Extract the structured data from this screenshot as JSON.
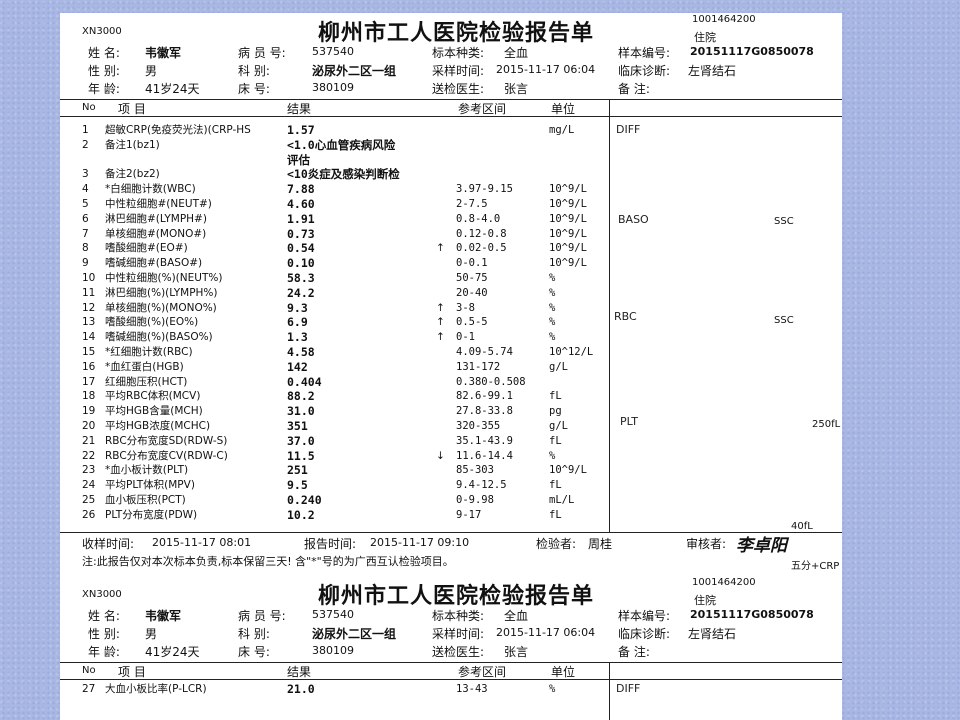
{
  "report": {
    "analyzer": "XN3000",
    "hospital_title": "柳州市工人医院检验报告单",
    "patient_id": "1001464200",
    "admission": "住院",
    "fields": {
      "name_label": "姓 名:",
      "name": "韦徽军",
      "sex_label": "性 别:",
      "sex": "男",
      "age_label": "年 龄:",
      "age": "41岁24天",
      "case_label": "病 员 号:",
      "case_no": "537540",
      "dept_label": "科    别:",
      "dept": "泌尿外二区一组",
      "bed_label": "床    号:",
      "bed": "380109",
      "specimen_type_label": "标本种类:",
      "specimen_type": "全血",
      "collect_time_label": "采样时间:",
      "collect_time": "2015-11-17 06:04",
      "doctor_label": "送检医生:",
      "doctor": "张言",
      "sample_no_label": "样本编号:",
      "sample_no": "20151117G0850078",
      "diagnosis_label": "临床诊断:",
      "diagnosis": "左肾结石",
      "remark_label": "备    注:",
      "remark": ""
    },
    "columns": {
      "no": "No",
      "item": "项    目",
      "result": "结果",
      "ref": "参考区间",
      "unit": "单位"
    },
    "rows": [
      {
        "no": "1",
        "name": "超敏CRP(免疫荧光法)(CRP-HS",
        "result": "1.57",
        "flag": "",
        "ref": "",
        "unit": "mg/L"
      },
      {
        "no": "2",
        "name": "备注1(bz1)",
        "result": "<1.0心血管疾病风险",
        "flag": "",
        "ref": "",
        "unit": ""
      },
      {
        "no": "",
        "name": "",
        "result": "评估",
        "flag": "",
        "ref": "",
        "unit": ""
      },
      {
        "no": "3",
        "name": "备注2(bz2)",
        "result": "<10炎症及感染判断检",
        "flag": "",
        "ref": "",
        "unit": ""
      },
      {
        "no": "4",
        "name": "*白细胞计数(WBC)",
        "result": "7.88",
        "flag": "",
        "ref": "3.97-9.15",
        "unit": "10^9/L"
      },
      {
        "no": "5",
        "name": "中性粒细胞#(NEUT#)",
        "result": "4.60",
        "flag": "",
        "ref": "2-7.5",
        "unit": "10^9/L"
      },
      {
        "no": "6",
        "name": "淋巴细胞#(LYMPH#)",
        "result": "1.91",
        "flag": "",
        "ref": "0.8-4.0",
        "unit": "10^9/L"
      },
      {
        "no": "7",
        "name": "单核细胞#(MONO#)",
        "result": "0.73",
        "flag": "",
        "ref": "0.12-0.8",
        "unit": "10^9/L"
      },
      {
        "no": "8",
        "name": "嗜酸细胞#(EO#)",
        "result": "0.54",
        "flag": "↑",
        "ref": "0.02-0.5",
        "unit": "10^9/L"
      },
      {
        "no": "9",
        "name": "嗜碱细胞#(BASO#)",
        "result": "0.10",
        "flag": "",
        "ref": "0-0.1",
        "unit": "10^9/L"
      },
      {
        "no": "10",
        "name": "中性粒细胞(%)(NEUT%)",
        "result": "58.3",
        "flag": "",
        "ref": "50-75",
        "unit": "%"
      },
      {
        "no": "11",
        "name": "淋巴细胞(%)(LYMPH%)",
        "result": "24.2",
        "flag": "",
        "ref": "20-40",
        "unit": "%"
      },
      {
        "no": "12",
        "name": "单核细胞(%)(MONO%)",
        "result": "9.3",
        "flag": "↑",
        "ref": "3-8",
        "unit": "%"
      },
      {
        "no": "13",
        "name": "嗜酸细胞(%)(EO%)",
        "result": "6.9",
        "flag": "↑",
        "ref": "0.5-5",
        "unit": "%"
      },
      {
        "no": "14",
        "name": "嗜碱细胞(%)(BASO%)",
        "result": "1.3",
        "flag": "↑",
        "ref": "0-1",
        "unit": "%"
      },
      {
        "no": "15",
        "name": "*红细胞计数(RBC)",
        "result": "4.58",
        "flag": "",
        "ref": "4.09-5.74",
        "unit": "10^12/L"
      },
      {
        "no": "16",
        "name": "*血红蛋白(HGB)",
        "result": "142",
        "flag": "",
        "ref": "131-172",
        "unit": "g/L"
      },
      {
        "no": "17",
        "name": "红细胞压积(HCT)",
        "result": "0.404",
        "flag": "",
        "ref": "0.380-0.508",
        "unit": ""
      },
      {
        "no": "18",
        "name": "平均RBC体积(MCV)",
        "result": "88.2",
        "flag": "",
        "ref": "82.6-99.1",
        "unit": "fL"
      },
      {
        "no": "19",
        "name": "平均HGB含量(MCH)",
        "result": "31.0",
        "flag": "",
        "ref": "27.8-33.8",
        "unit": "pg"
      },
      {
        "no": "20",
        "name": "平均HGB浓度(MCHC)",
        "result": "351",
        "flag": "",
        "ref": "320-355",
        "unit": "g/L"
      },
      {
        "no": "21",
        "name": "RBC分布宽度SD(RDW-S)",
        "result": "37.0",
        "flag": "",
        "ref": "35.1-43.9",
        "unit": "fL"
      },
      {
        "no": "22",
        "name": "RBC分布宽度CV(RDW-C)",
        "result": "11.5",
        "flag": "↓",
        "ref": "11.6-14.4",
        "unit": "%"
      },
      {
        "no": "23",
        "name": "*血小板计数(PLT)",
        "result": "251",
        "flag": "",
        "ref": "85-303",
        "unit": "10^9/L"
      },
      {
        "no": "24",
        "name": "平均PLT体积(MPV)",
        "result": "9.5",
        "flag": "",
        "ref": "9.4-12.5",
        "unit": "fL"
      },
      {
        "no": "25",
        "name": "血小板压积(PCT)",
        "result": "0.240",
        "flag": "",
        "ref": "0-9.98",
        "unit": "mL/L"
      },
      {
        "no": "26",
        "name": "PLT分布宽度(PDW)",
        "result": "10.2",
        "flag": "",
        "ref": "9-17",
        "unit": "fL"
      }
    ],
    "graphs": {
      "diff": "DIFF",
      "baso": "BASO",
      "rbc": "RBC",
      "plt": "PLT",
      "ssc1": "SSC",
      "ssc2": "SSC",
      "plt_max": "250fL",
      "plt_min": "40fL"
    },
    "footer": {
      "receive_label": "收样时间:",
      "receive_time": "2015-11-17 08:01",
      "report_label": "报告时间:",
      "report_time": "2015-11-17 09:10",
      "inspector_label": "检验者:",
      "inspector": "周桂",
      "reviewer_label": "审核者:",
      "reviewer_signature": "李卓阳",
      "note": "注:此报告仅对本次标本负责,标本保留三天! 含\"*\"号的为广西互认检验项目。",
      "extra": "五分+CRP"
    },
    "second_page_row": {
      "no": "27",
      "name": "大血小板比率(P-LCR)",
      "result": "21.0",
      "ref": "13-43",
      "unit": "%",
      "graph": "DIFF"
    }
  }
}
